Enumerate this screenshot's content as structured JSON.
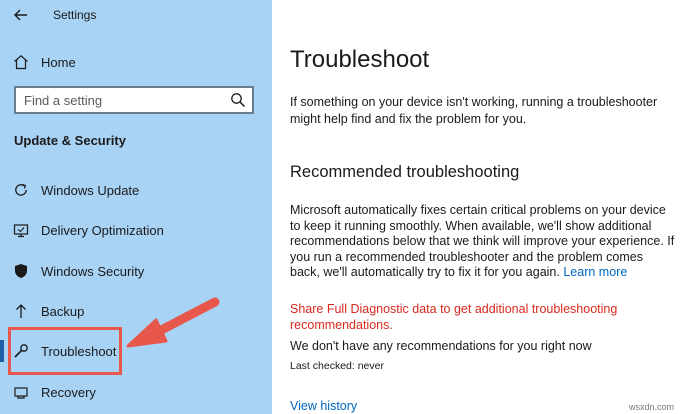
{
  "window": {
    "app_title": "Settings"
  },
  "sidebar": {
    "home_label": "Home",
    "search_placeholder": "Find a setting",
    "section_heading": "Update & Security",
    "items": [
      {
        "label": "Windows Update",
        "icon": "refresh-icon"
      },
      {
        "label": "Delivery Optimization",
        "icon": "delivery-optimization-icon"
      },
      {
        "label": "Windows Security",
        "icon": "shield-icon"
      },
      {
        "label": "Backup",
        "icon": "backup-arrow-icon"
      },
      {
        "label": "Troubleshoot",
        "icon": "wrench-icon",
        "selected": true
      },
      {
        "label": "Recovery",
        "icon": "recovery-icon"
      }
    ]
  },
  "main": {
    "title": "Troubleshoot",
    "intro": "If something on your device isn't working, running a troubleshooter might help find and fix the problem for you.",
    "recommended_heading": "Recommended troubleshooting",
    "recommended_body": "Microsoft automatically fixes certain critical problems on your device to keep it running smoothly. When available, we'll show additional recommendations below that we think will improve your experience. If you run a recommended troubleshooter and the problem comes back, we'll automatically try to fix it for you again.",
    "learn_more_label": "Learn more",
    "diagnostic_link": "Share Full Diagnostic data to get additional troubleshooting recommendations.",
    "no_recommendations": "We don't have any recommendations for you right now",
    "last_checked": "Last checked: never",
    "view_history_label": "View history"
  },
  "watermark": "wsxdn.com",
  "colors": {
    "sidebar_bg": "#a9d3f5",
    "accent": "#0067c0",
    "diagnostic_red": "#d92a1e",
    "annotation_red": "#e8574b"
  }
}
